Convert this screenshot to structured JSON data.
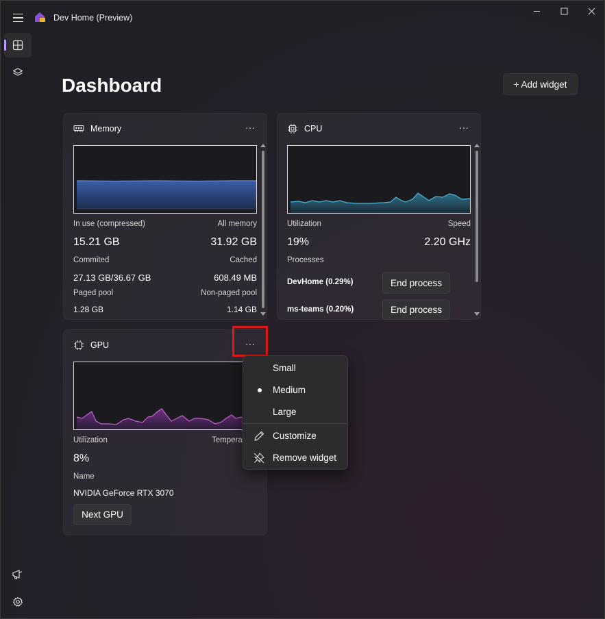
{
  "app": {
    "title": "Dev Home (Preview)"
  },
  "nav": {
    "items": [
      "dashboard-icon",
      "layers-icon"
    ],
    "bottom": [
      "feedback-icon",
      "settings-icon"
    ]
  },
  "header": {
    "title": "Dashboard",
    "add_widget_label": "+ Add widget"
  },
  "memory": {
    "title": "Memory",
    "more": "···",
    "in_use_label": "In use (compressed)",
    "all_label": "All memory",
    "in_use_value": "15.21 GB",
    "all_value": "31.92 GB",
    "committed_label": "Commited",
    "cached_label": "Cached",
    "committed_value": "27.13 GB/36.67 GB",
    "cached_value": "608.49 MB",
    "paged_label": "Paged pool",
    "nonpaged_label": "Non-paged pool",
    "paged_value": "1.28 GB",
    "nonpaged_value": "1.14 GB"
  },
  "cpu": {
    "title": "CPU",
    "more": "···",
    "util_label": "Utilization",
    "speed_label": "Speed",
    "util_value": "19%",
    "speed_value": "2.20 GHz",
    "processes_label": "Processes",
    "proc1": "DevHome (0.29%)",
    "proc2": "ms-teams (0.20%)",
    "end_label": "End process"
  },
  "gpu": {
    "title": "GPU",
    "more": "···",
    "util_label": "Utilization",
    "temp_label": "Tempera",
    "util_value": "8%",
    "name_label": "Name",
    "name_value": "NVIDIA GeForce RTX 3070",
    "next_label": "Next GPU"
  },
  "context_menu": {
    "small": "Small",
    "medium": "Medium",
    "large": "Large",
    "customize": "Customize",
    "remove": "Remove widget",
    "selected": "Medium"
  },
  "colors": {
    "memory_chart": "#3a5a9a",
    "cpu_chart": "#3aa6c8",
    "gpu_chart": "#b44fc0",
    "highlight": "#e01a1a"
  }
}
